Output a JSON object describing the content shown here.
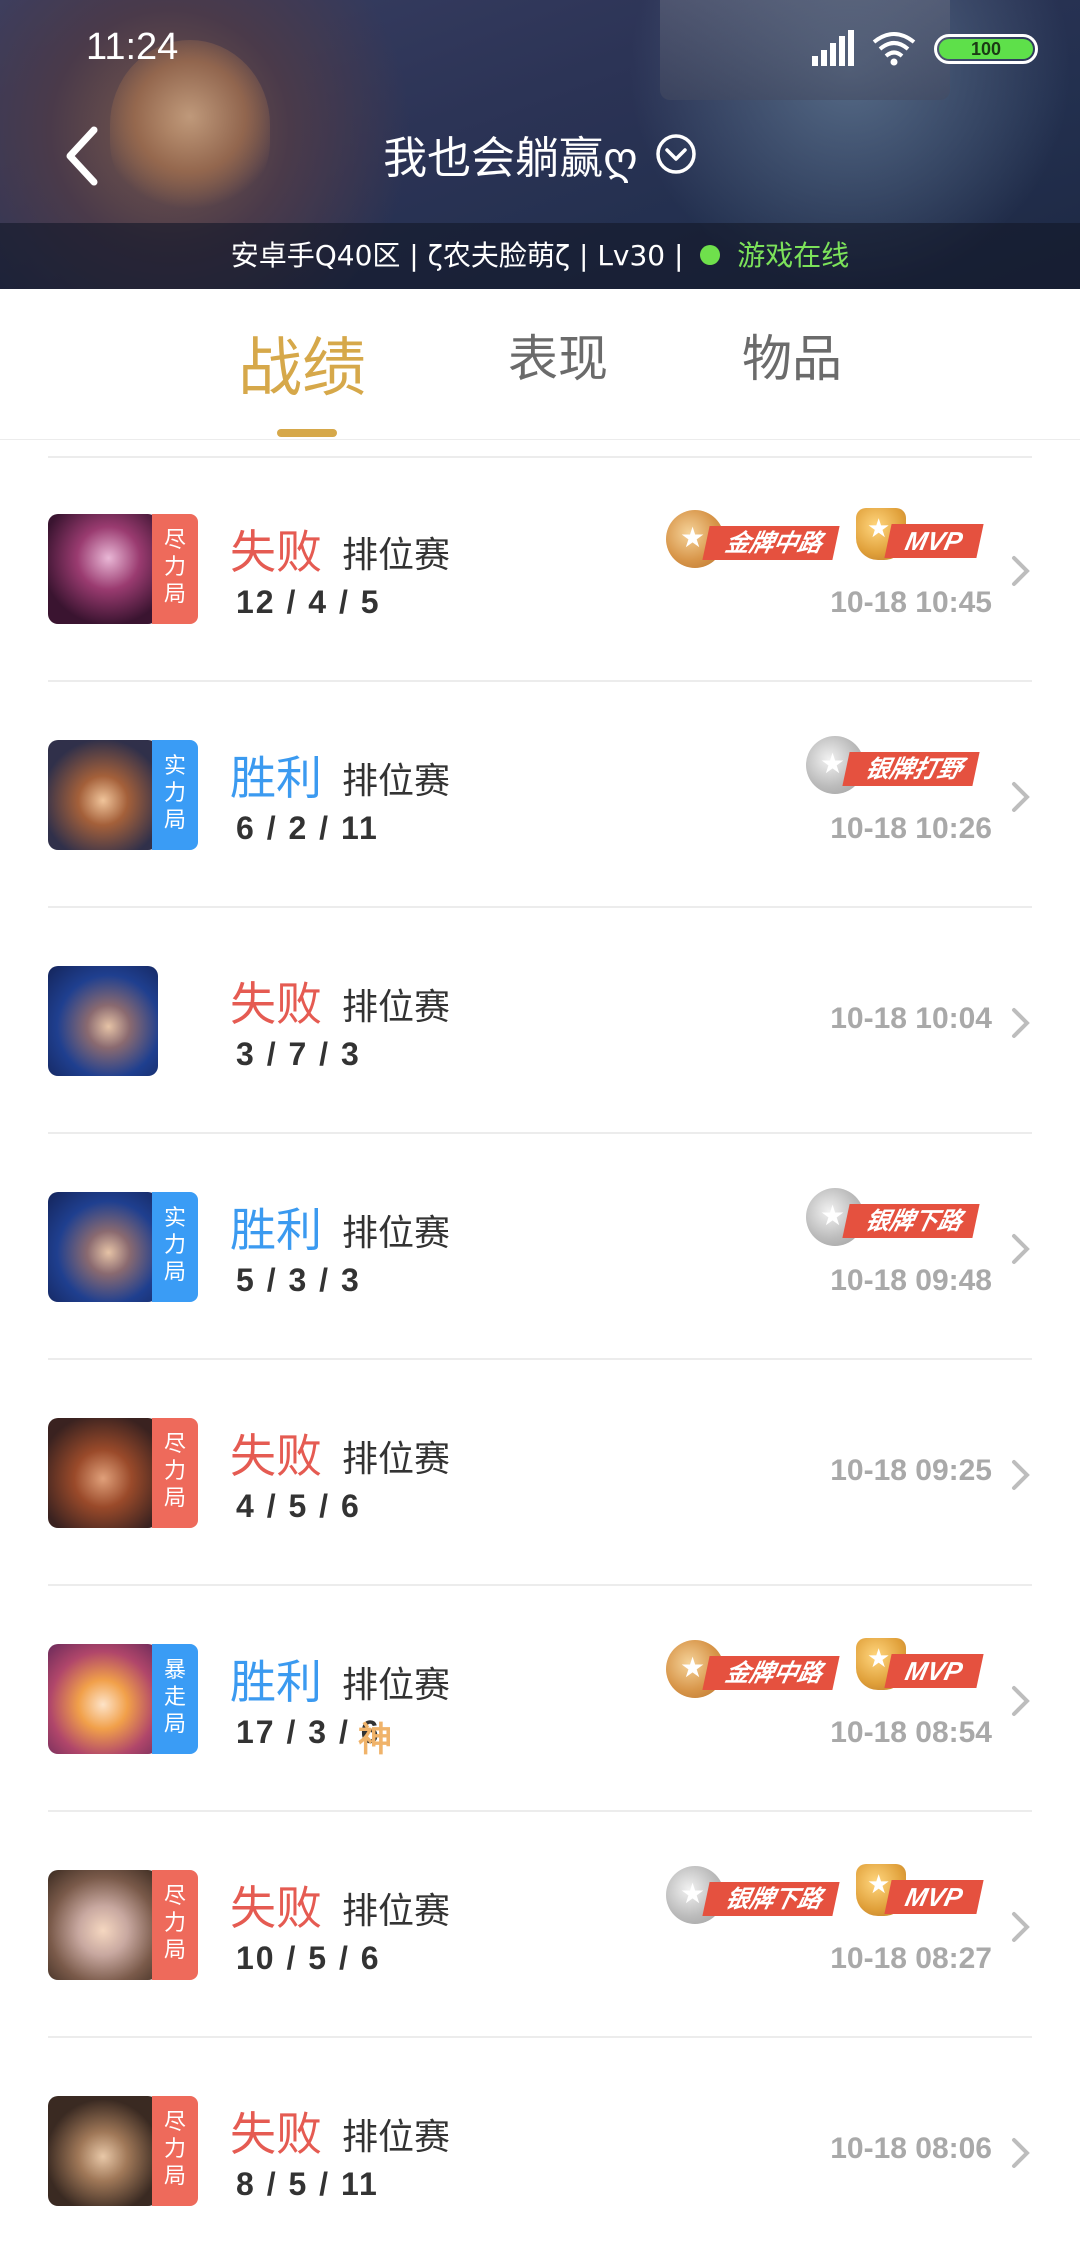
{
  "status_bar": {
    "time": "11:24",
    "battery": "100",
    "icons": [
      "signal-icon",
      "wifi-icon",
      "battery-icon"
    ]
  },
  "header": {
    "back_icon": "back-arrow-icon",
    "title": "我也会躺赢ღ",
    "title_icon": "chevron-down-circle-icon",
    "info_text": "安卓手Q40区 | ζ农夫脸萌ζ | Lv30 |",
    "online_status": "游戏在线",
    "online_color": "#6fe04c"
  },
  "tabs": [
    {
      "label": "战绩",
      "active": true
    },
    {
      "label": "表现",
      "active": false
    },
    {
      "label": "物品",
      "active": false
    }
  ],
  "colors": {
    "accent": "#d6a84a",
    "lose": "#e55b52",
    "win": "#3b9af0",
    "tag_red": "#ee6a5b",
    "tag_blue": "#3a9cf5"
  },
  "matches": [
    {
      "result": "失败",
      "mode": "排位赛",
      "kda": "12 / 4 / 5",
      "time": "10-18 10:45",
      "tag": "尽\n力\n局",
      "medal": "金牌中路",
      "mvp": "MVP"
    },
    {
      "result": "胜利",
      "mode": "排位赛",
      "kda": "6 / 2 / 11",
      "time": "10-18 10:26",
      "tag": "实\n力\n局",
      "medal": "银牌打野",
      "mvp": ""
    },
    {
      "result": "失败",
      "mode": "排位赛",
      "kda": "3 / 7 / 3",
      "time": "10-18 10:04",
      "tag": "",
      "medal": "",
      "mvp": ""
    },
    {
      "result": "胜利",
      "mode": "排位赛",
      "kda": "5 / 3 / 3",
      "time": "10-18 09:48",
      "tag": "实\n力\n局",
      "medal": "银牌下路",
      "mvp": ""
    },
    {
      "result": "失败",
      "mode": "排位赛",
      "kda": "4 / 5 / 6",
      "time": "10-18 09:25",
      "tag": "尽\n力\n局",
      "medal": "",
      "mvp": ""
    },
    {
      "result": "胜利",
      "mode": "排位赛",
      "kda": "17 / 3 / 6",
      "god": "神",
      "time": "10-18 08:54",
      "tag": "暴\n走\n局",
      "medal": "金牌中路",
      "mvp": "MVP"
    },
    {
      "result": "失败",
      "mode": "排位赛",
      "kda": "10 / 5 / 6",
      "time": "10-18 08:27",
      "tag": "尽\n力\n局",
      "medal": "银牌下路",
      "mvp": "MVP"
    },
    {
      "result": "失败",
      "mode": "排位赛",
      "kda": "8 / 5 / 11",
      "time": "10-18 08:06",
      "tag": "尽\n力\n局",
      "medal": "",
      "mvp": ""
    }
  ]
}
